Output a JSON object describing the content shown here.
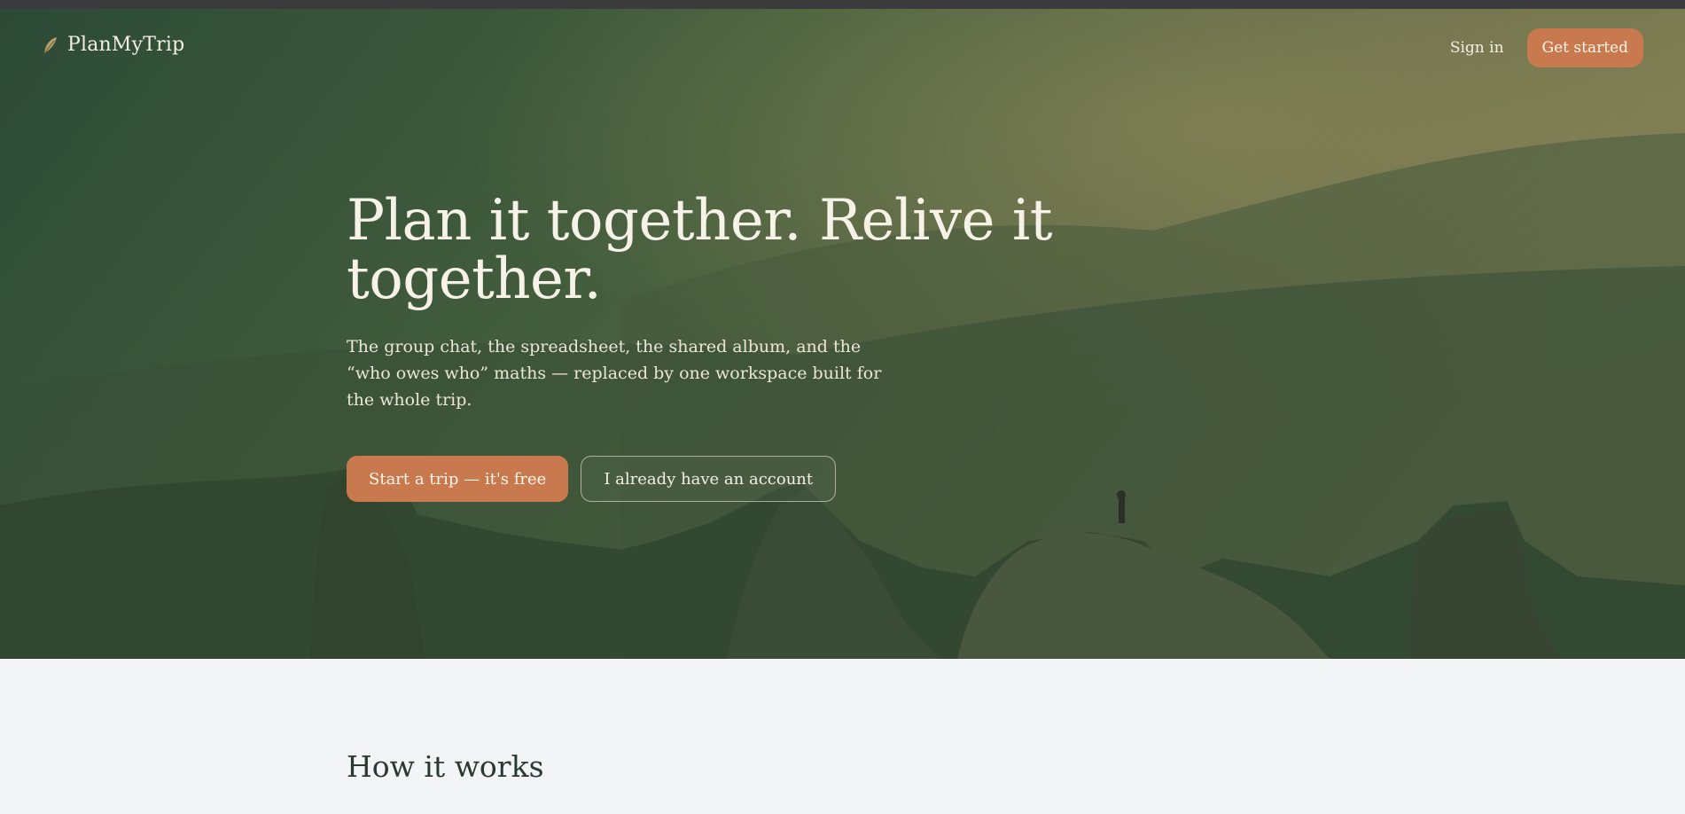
{
  "brand": {
    "name": "PlanMyTrip",
    "icon": "leaf-icon"
  },
  "nav": {
    "signin_label": "Sign in",
    "get_started_label": "Get started"
  },
  "hero": {
    "title": "Plan it together. Relive it together.",
    "subtitle": "The group chat, the spreadsheet, the shared album, and the “who owes who” maths — replaced by one workspace built for the whole trip.",
    "primary_cta": "Start a trip — it's free",
    "secondary_cta": "I already have an account"
  },
  "sections": {
    "how_it_works_title": "How it works"
  },
  "colors": {
    "accent": "#c87a4e",
    "hero_dark": "#2f4d39",
    "hero_light": "#8a8458",
    "page_bg": "#f3f4f6"
  }
}
